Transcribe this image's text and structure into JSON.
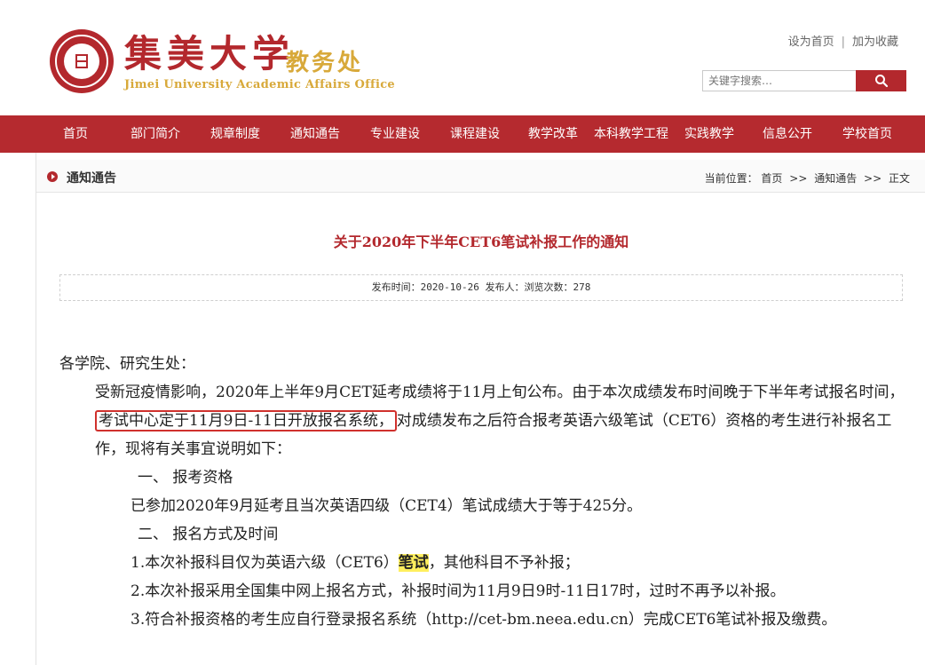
{
  "header": {
    "school_cn": "集美大学",
    "office_cn": "教务处",
    "school_en": "Jimei University Academic Affairs Office",
    "links": [
      "设为首页",
      "加为收藏"
    ],
    "search_placeholder": "关键字搜索…"
  },
  "nav": {
    "items": [
      "首页",
      "部门简介",
      "规章制度",
      "通知通告",
      "专业建设",
      "课程建设",
      "教学改革",
      "本科教学工程",
      "实践教学",
      "信息公开",
      "学校首页"
    ]
  },
  "crumb": {
    "section_title": "通知通告",
    "label": "当前位置：",
    "path": [
      "首页",
      "通知通告",
      "正文"
    ],
    "separator": ">>"
  },
  "article": {
    "title": "关于2020年下半年CET6笔试补报工作的通知",
    "meta": "发布时间：2020-10-26 发布人：浏览次数：278",
    "salutation": "各学院、研究生处：",
    "p1_a": "受新冠疫情影响，2020年上半年9月CET延考成绩将于11月上旬公布。由于本次成绩发布时间晚于下半年考试报名时间，",
    "p1_boxed": "考试中心定于11月9日-11日开放报名系统，",
    "p1_b": "对成绩发布之后符合报考英语六级笔试（CET6）资格的考生进行补报名工作，现将有关事宜说明如下：",
    "h1": "一、  报考资格",
    "p2": "已参加2020年9月延考且当次英语四级（CET4）笔试成绩大于等于425分。",
    "h2": "二、  报名方式及时间",
    "l1_a": "1.本次补报科目仅为英语六级（CET6）",
    "l1_hl": "笔试",
    "l1_b": "，其他科目不予补报；",
    "l2": "2.本次补报采用全国集中网上报名方式，补报时间为11月9日9时-11日17时，过时不再予以补报。",
    "l3": "3.符合补报资格的考生应自行登录报名系统（http://cet-bm.neea.edu.cn）完成CET6笔试补报及缴费。"
  },
  "colors": {
    "brand_red": "#b3282d",
    "gold": "#d8a93a",
    "highlight": "#ffef5e"
  }
}
